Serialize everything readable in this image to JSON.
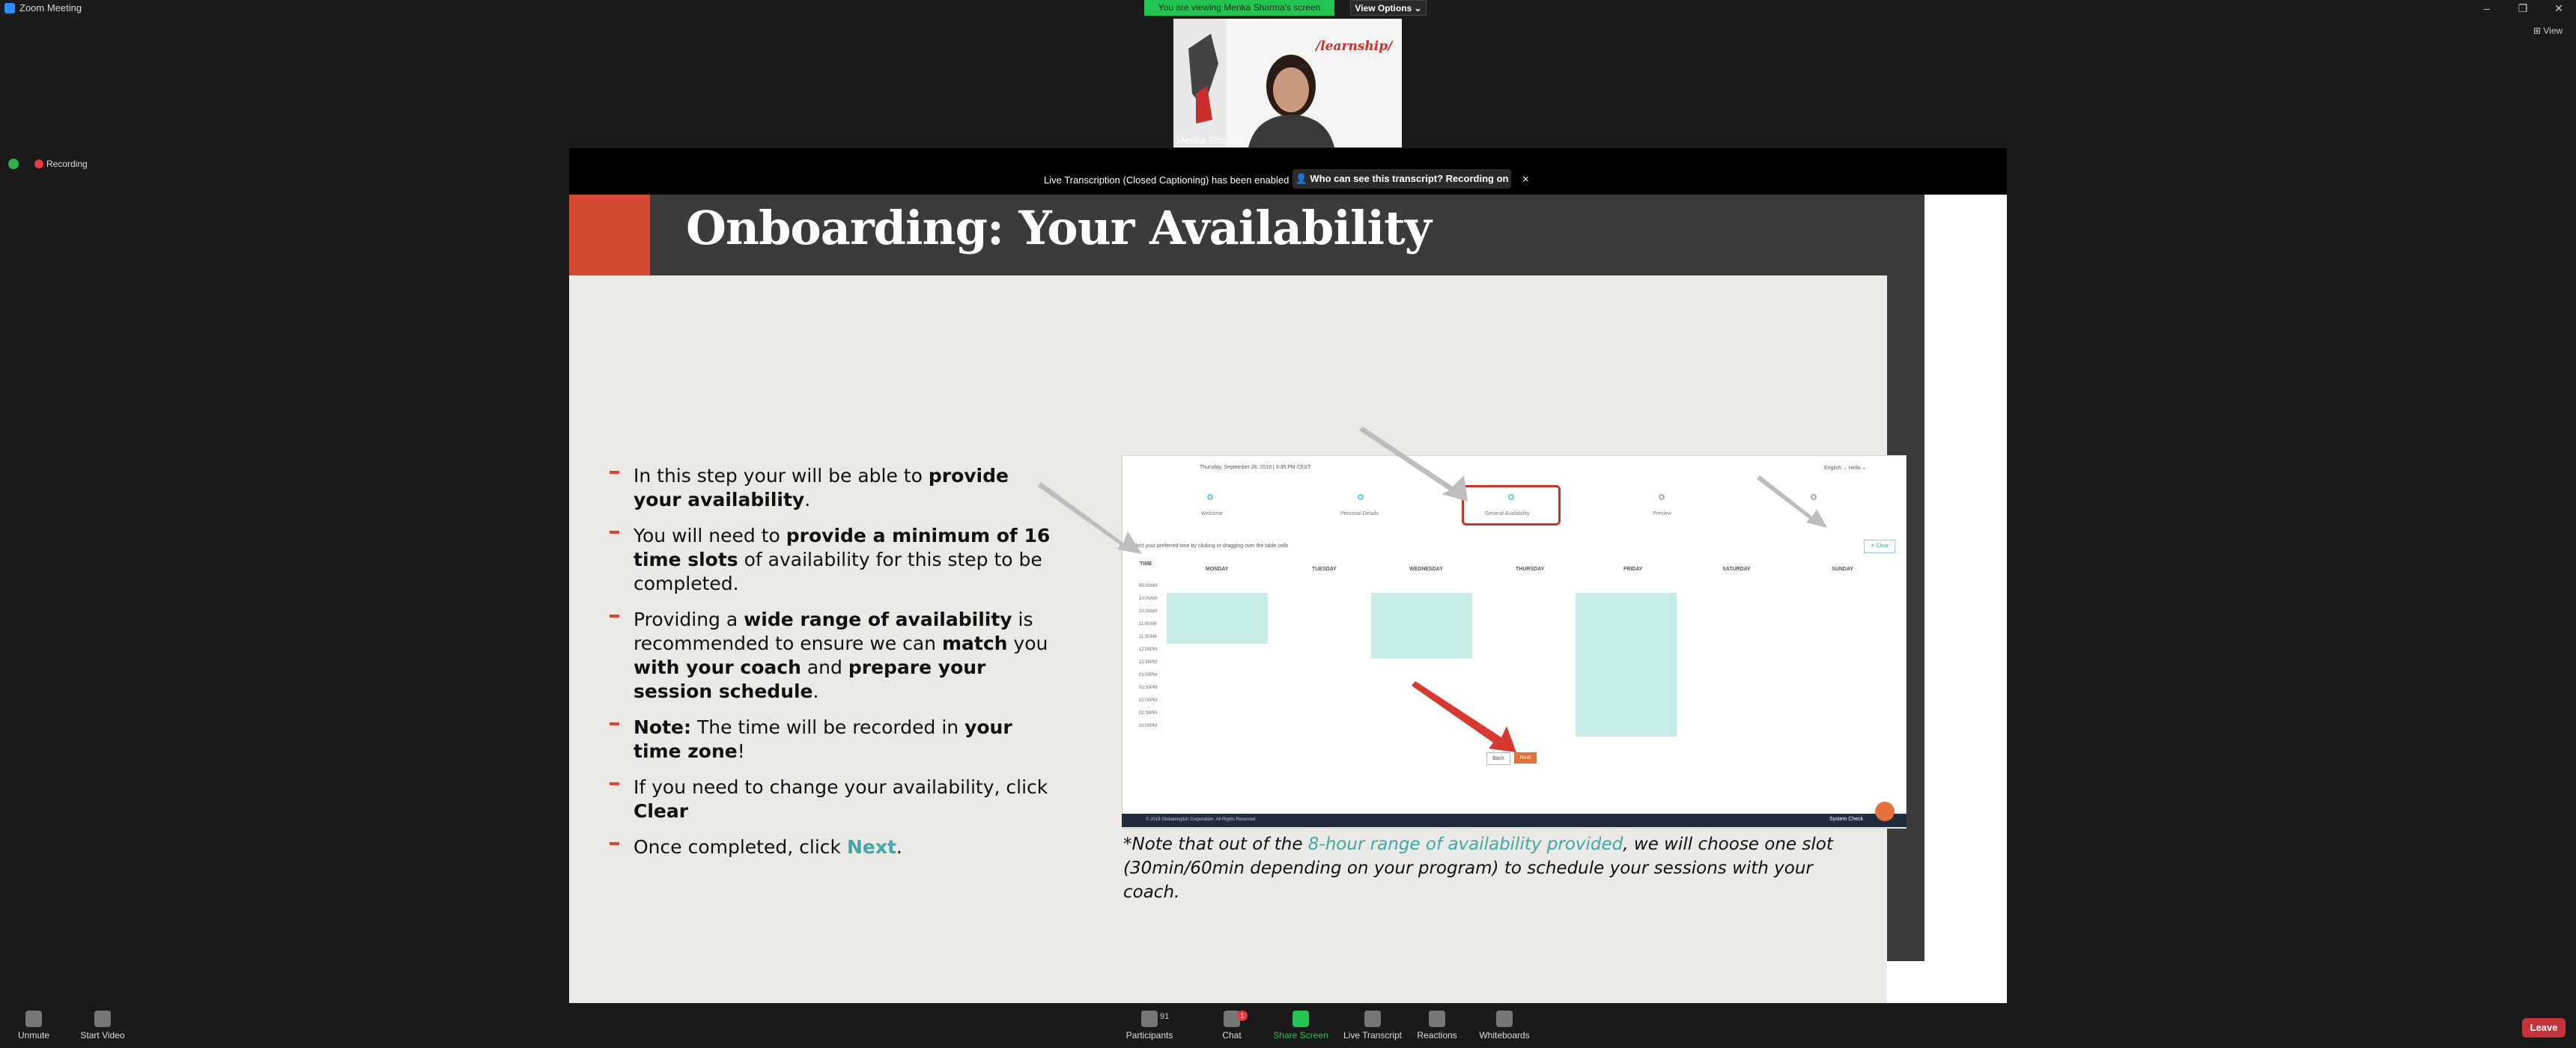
{
  "window": {
    "title": "Zoom Meeting",
    "minimize": "–",
    "restore": "❐",
    "close": "✕"
  },
  "banner": {
    "viewing": "You are viewing Menka Sharma's screen",
    "view_options": "View Options ⌄",
    "view_right": "⊞ View"
  },
  "recording": {
    "label": "Recording"
  },
  "video": {
    "participant_name": "Menka Sharma",
    "backdrop_text": "/learnship/"
  },
  "captions": {
    "notice": "Live Transcription (Closed Captioning) has been enabled",
    "who_button": "Who can see this transcript? Recording on",
    "close": "×"
  },
  "slide": {
    "title": "Onboarding: Your Availability",
    "bullets": [
      {
        "pre": "In this step your will be able to ",
        "bold": "provide your availability",
        "post": "."
      },
      {
        "pre": "You will need to ",
        "bold": "provide a minimum of 16 time slots",
        "post": " of availability for this step to be completed."
      },
      {
        "p1": "Providing a ",
        "b1": "wide range of availability",
        "p2": " is recommended to ensure we can ",
        "b2": "match",
        "p3": " you ",
        "b3": "with your coach",
        "p4": " and ",
        "b4": "prepare your session schedule",
        "p5": "."
      },
      {
        "b1": "Note:",
        "p1": " The time will be recorded in ",
        "b2": "your time zone",
        "p2": "!"
      },
      {
        "pre": "If you need to change your availability, click ",
        "bold": "Clear",
        "post": ""
      },
      {
        "pre": "Once completed, click ",
        "bold": "Next",
        "post": "."
      }
    ],
    "note": {
      "pre": "*Note that out of the ",
      "highlight": "8-hour range of availability provided",
      "post": ", we will choose one slot (30min/60min depending on your program) to schedule your sessions with your coach."
    }
  },
  "embed": {
    "date": "Thursday, September 26, 2019 | 3:35 PM CEST",
    "user": "English ⌄   Hello ⌄",
    "steps": [
      "Welcome",
      "Personal Details",
      "General Availability",
      "Preview"
    ],
    "instruction": "Select your preferred time by clicking or dragging over the table cells",
    "clear": "✕ Clear",
    "time_header": "TIME",
    "days": [
      "MONDAY",
      "TUESDAY",
      "WEDNESDAY",
      "THURSDAY",
      "FRIDAY",
      "SATURDAY",
      "SUNDAY"
    ],
    "times": [
      "09:30AM",
      "10:00AM",
      "10:30AM",
      "11:00AM",
      "11:30AM",
      "12:00PM",
      "12:30PM",
      "01:00PM",
      "01:30PM",
      "02:00PM",
      "02:30PM",
      "03:00PM"
    ],
    "back": "Back",
    "next": "Next",
    "footer": "© 2019 Globalenglish Corporation. All Rights Reserved.",
    "status": "System Check"
  },
  "toolbar": {
    "unmute": "Unmute",
    "start_video": "Start Video",
    "participants": "Participants",
    "participants_count": "91",
    "chat": "Chat",
    "chat_badge": "1",
    "share_screen": "Share Screen",
    "live_transcript": "Live Transcript",
    "reactions": "Reactions",
    "whiteboards": "Whiteboards",
    "leave": "Leave"
  },
  "colors": {
    "accent_red": "#d64933",
    "share_green": "#23c552",
    "teal": "#3fa8a8",
    "leave_red": "#c7353c"
  }
}
